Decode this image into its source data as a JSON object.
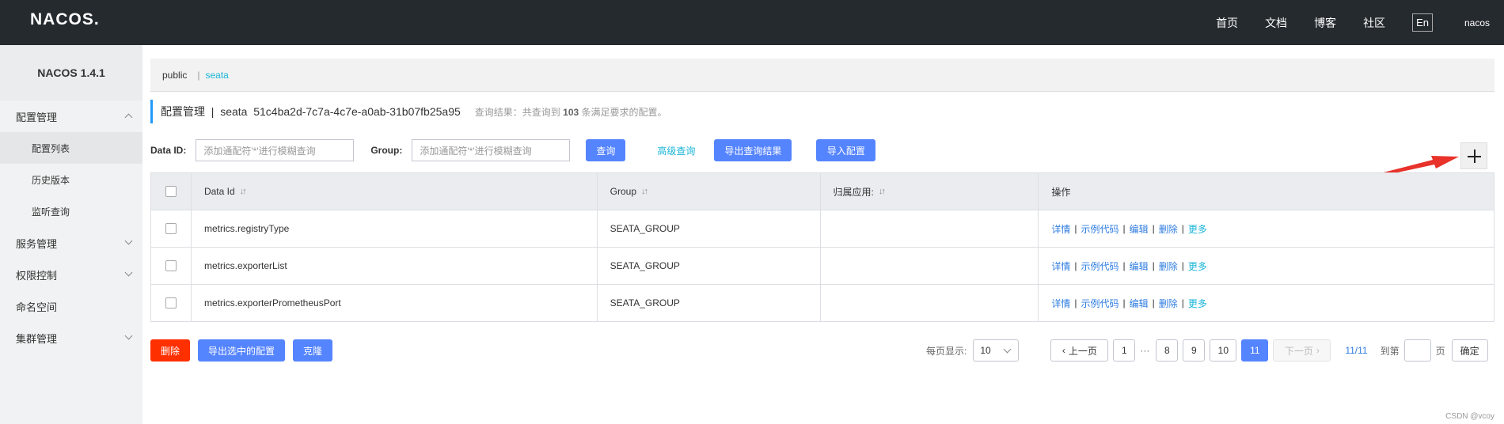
{
  "topbar": {
    "logo": "NACOS.",
    "nav": [
      "首页",
      "文档",
      "博客",
      "社区"
    ],
    "lang": "En",
    "user": "nacos"
  },
  "sidebar": {
    "version": "NACOS 1.4.1",
    "items": [
      {
        "label": "配置管理",
        "type": "group",
        "expanded": true
      },
      {
        "label": "配置列表",
        "type": "sub",
        "active": true
      },
      {
        "label": "历史版本",
        "type": "sub"
      },
      {
        "label": "监听查询",
        "type": "sub"
      },
      {
        "label": "服务管理",
        "type": "group",
        "expanded": false
      },
      {
        "label": "权限控制",
        "type": "group",
        "expanded": false
      },
      {
        "label": "命名空间",
        "type": "plain"
      },
      {
        "label": "集群管理",
        "type": "group",
        "expanded": false
      }
    ]
  },
  "namespace": {
    "items": [
      "public",
      "seata"
    ],
    "separator": "|"
  },
  "title": {
    "text": "配置管理  |  seata  51c4ba2d-7c7a-4c7e-a0ab-31b07fb25a95",
    "hint_prefix": "查询结果：共查询到",
    "hint_count": "103",
    "hint_suffix": "条满足要求的配置。"
  },
  "filter": {
    "dataid_label": "Data ID:",
    "dataid_placeholder": "添加通配符'*'进行模糊查询",
    "group_label": "Group:",
    "group_placeholder": "添加通配符'*'进行模糊查询",
    "query": "查询",
    "advanced": "高级查询",
    "export_results": "导出查询结果",
    "import": "导入配置"
  },
  "table": {
    "headers": [
      "Data Id",
      "Group",
      "归属应用:",
      "操作"
    ],
    "sort_icon": "↓↑",
    "rows": [
      {
        "data_id": "metrics.registryType",
        "group": "SEATA_GROUP",
        "app": ""
      },
      {
        "data_id": "metrics.exporterList",
        "group": "SEATA_GROUP",
        "app": ""
      },
      {
        "data_id": "metrics.exporterPrometheusPort",
        "group": "SEATA_GROUP",
        "app": ""
      }
    ],
    "ops": {
      "detail": "详情",
      "sample": "示例代码",
      "edit": "编辑",
      "delete": "删除",
      "more": "更多",
      "sep": "|"
    }
  },
  "bottom": {
    "delete": "删除",
    "export_selected": "导出选中的配置",
    "clone": "克隆"
  },
  "pager": {
    "page_size_label": "每页显示:",
    "page_size": "10",
    "prev": "上一页",
    "pages": [
      "1",
      "···",
      "8",
      "9",
      "10",
      "11"
    ],
    "current": "11",
    "next": "下一页",
    "summary": "11/11",
    "goto_label": "到第",
    "page_unit": "页",
    "confirm": "确定"
  },
  "watermark": "CSDN @vcoy",
  "colors": {
    "primary": "#5584ff",
    "danger": "#ff3000",
    "topbar": "#252a2f",
    "link": "#19b5d8",
    "arrow": "#e8322a"
  }
}
